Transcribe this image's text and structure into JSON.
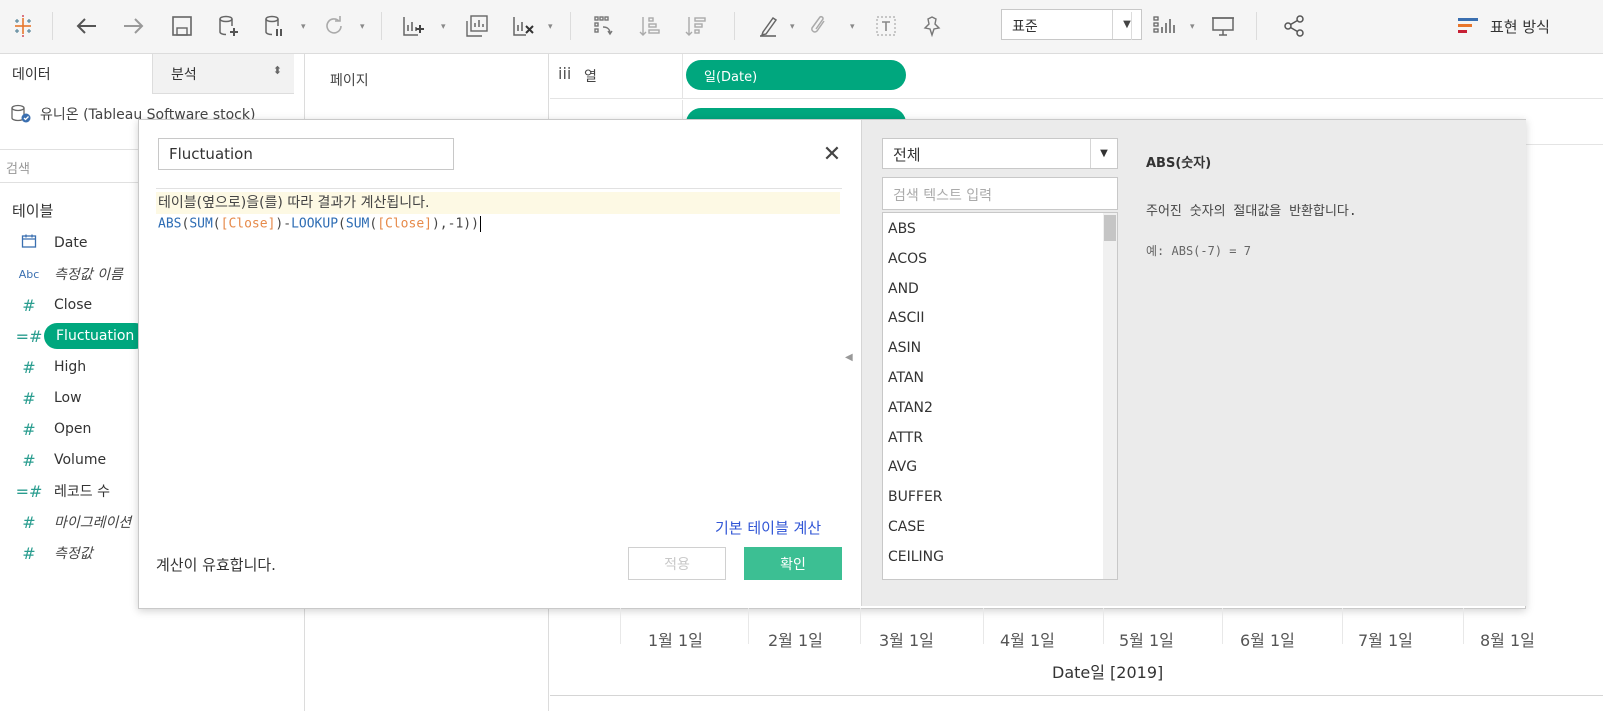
{
  "toolbar": {
    "view_size": "표준",
    "show_me": "표현 방식",
    "icons": [
      "tableau-logo-icon",
      "back-icon",
      "forward-icon",
      "save-icon",
      "new-datasource-icon",
      "pause-updates-icon",
      "refresh-icon",
      "new-worksheet-icon",
      "duplicate-icon",
      "clear-icon",
      "swap-icon",
      "sort-asc-icon",
      "sort-desc-icon",
      "highlight-icon",
      "group-icon",
      "label-icon",
      "fix-axes-icon",
      "fit-icon",
      "presentation-icon",
      "share-icon",
      "show-me-icon"
    ]
  },
  "left_panel": {
    "tab_data": "데이터",
    "tab_analysis": "분석",
    "datasource": "유니온 (Tableau Software stock)",
    "search_placeholder": "검색",
    "tables_heading": "테이블",
    "fields": [
      {
        "name": "Date",
        "type": "date",
        "icon": "calendar-icon",
        "italic": false
      },
      {
        "name": "측정값 이름",
        "type": "string",
        "icon": "abc-icon",
        "italic": true
      },
      {
        "name": "Close",
        "type": "measure",
        "icon": "hash-icon",
        "italic": false
      },
      {
        "name": "Fluctuation",
        "type": "calculated-measure",
        "icon": "calc-hash-icon",
        "italic": false,
        "selected": true
      },
      {
        "name": "High",
        "type": "measure",
        "icon": "hash-icon",
        "italic": false
      },
      {
        "name": "Low",
        "type": "measure",
        "icon": "hash-icon",
        "italic": false
      },
      {
        "name": "Open",
        "type": "measure",
        "icon": "hash-icon",
        "italic": false
      },
      {
        "name": "Volume",
        "type": "measure",
        "icon": "hash-icon",
        "italic": false
      },
      {
        "name": "레코드 수",
        "type": "calculated-measure",
        "icon": "calc-hash-icon",
        "italic": false
      },
      {
        "name": "마이그레이션",
        "type": "measure",
        "icon": "hash-icon",
        "italic": true
      },
      {
        "name": "측정값",
        "type": "measure",
        "icon": "hash-icon",
        "italic": true
      }
    ]
  },
  "pages": {
    "label": "페이지"
  },
  "shelves": {
    "columns_label": "열",
    "columns_pill": "일(Date)",
    "rows_pill": ""
  },
  "chart": {
    "x_ticks": [
      "1월 1일",
      "2월 1일",
      "3월 1일",
      "4월 1일",
      "5월 1일",
      "6월 1일",
      "7월 1일",
      "8월 1일"
    ],
    "x_label": "Date일 [2019]"
  },
  "dialog": {
    "calc_name": "Fluctuation",
    "note": "테이블(옆으로)을(를) 따라 결과가 계산됩니다.",
    "formula": "ABS(SUM([Close])-LOOKUP(SUM([Close]),-1))",
    "default_calc_link": "기본 테이블 계산",
    "valid_message": "계산이 유효합니다.",
    "apply_label": "적용",
    "ok_label": "확인",
    "function_category": "전체",
    "function_search_placeholder": "검색 텍스트 입력",
    "functions": [
      "ABS",
      "ACOS",
      "AND",
      "ASCII",
      "ASIN",
      "ATAN",
      "ATAN2",
      "ATTR",
      "AVG",
      "BUFFER",
      "CASE",
      "CEILING"
    ],
    "help_title": "ABS(숫자)",
    "help_description": "주어진 숫자의 절대값을 반환합니다.",
    "help_example": "예: ABS(-7) = 7"
  },
  "colors": {
    "accent": "#00a77e",
    "ok_button": "#3cbf93",
    "link": "#3156d6",
    "note_bg": "#fdf9e4"
  }
}
